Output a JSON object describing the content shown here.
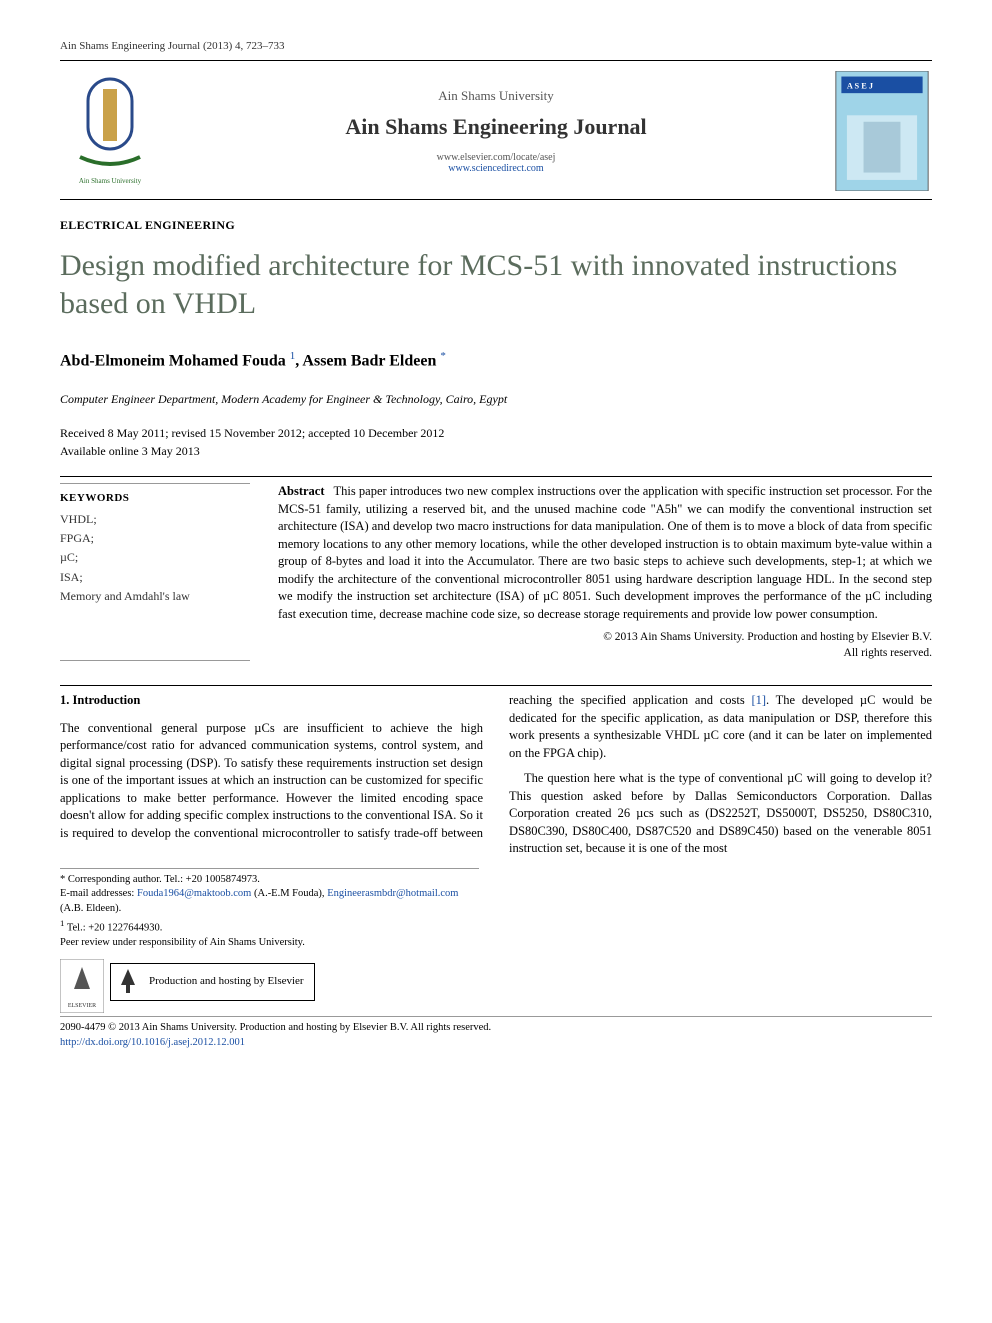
{
  "journal_ref": "Ain Shams Engineering Journal (2013) 4, 723–733",
  "header": {
    "university": "Ain Shams University",
    "journal": "Ain Shams Engineering Journal",
    "link1": "www.elsevier.com/locate/asej",
    "link2": "www.sciencedirect.com"
  },
  "section": "ELECTRICAL ENGINEERING",
  "title": "Design modified architecture for MCS-51 with innovated instructions based on VHDL",
  "authors": {
    "a1": "Abd-Elmoneim Mohamed Fouda",
    "a1_sup": "1",
    "a2": "Assem Badr Eldeen",
    "a2_sup": "*"
  },
  "affiliation": "Computer Engineer Department, Modern Academy for Engineer & Technology, Cairo, Egypt",
  "dates_line1": "Received 8 May 2011; revised 15 November 2012; accepted 10 December 2012",
  "dates_line2": "Available online 3 May 2013",
  "keywords": {
    "title": "KEYWORDS",
    "items": [
      "VHDL;",
      "FPGA;",
      "µC;",
      "ISA;",
      "Memory and Amdahl's law"
    ]
  },
  "abstract": {
    "label": "Abstract",
    "text": "This paper introduces two new complex instructions over the application with specific instruction set processor. For the MCS-51 family, utilizing a reserved bit, and the unused machine code \"A5h\" we can modify the conventional instruction set architecture (ISA) and develop two macro instructions for data manipulation. One of them is to move a block of data from specific memory locations to any other memory locations, while the other developed instruction is to obtain maximum byte-value within a group of 8-bytes and load it into the Accumulator. There are two basic steps to achieve such developments, step-1; at which we modify the architecture of the conventional microcontroller 8051 using hardware description language HDL. In the second step we modify the instruction set architecture (ISA) of µC 8051. Such development improves the performance of the µC including fast execution time, decrease machine code size, so decrease storage requirements and provide low power consumption.",
    "copyright1": "© 2013 Ain Shams University. Production and hosting by Elsevier B.V.",
    "copyright2": "All rights reserved."
  },
  "body": {
    "intro_heading": "1. Introduction",
    "p1": "The conventional general purpose µCs are insufficient to achieve the high performance/cost ratio for advanced communication systems, control system, and digital signal processing (DSP). To satisfy these requirements instruction set design is one of the important issues at which an instruction can be customized for specific applications to make better performance. However the limited encoding space doesn't allow for adding specific complex instructions to the conventional ISA. So it is required to develop the conventional microcontroller to satisfy trade-off between reaching the specified application and costs ",
    "ref1": "[1]",
    "p1b": ". The developed µC would be dedicated for the specific application, as data manipulation or DSP, therefore this work presents a synthesizable VHDL µC core (and it can be later on implemented on the FPGA chip).",
    "p2": "The question here what is the type of conventional µC will going to develop it? This question asked before by Dallas Semiconductors Corporation. Dallas Corporation created 26 µcs such as (DS2252T, DS5000T, DS5250, DS80C310, DS80C390, DS80C400, DS87C520 and DS89C450) based on the venerable 8051 instruction set, because it is one of the most"
  },
  "footnotes": {
    "star": "* Corresponding author. Tel.: +20 1005874973.",
    "emails_label": "E-mail addresses:",
    "email1": "Fouda1964@maktoob.com",
    "email1_who": " (A.-E.M Fouda), ",
    "email2": "Engineerasmbdr@hotmail.com",
    "email2_who": " (A.B. Eldeen).",
    "n1": "Tel.: +20 1227644930.",
    "peer": "Peer review under responsibility of Ain Shams University.",
    "hosting": "Production and hosting by Elsevier"
  },
  "footer": {
    "line1": "2090-4479 © 2013 Ain Shams University. Production and hosting by Elsevier B.V. All rights reserved.",
    "doi": "http://dx.doi.org/10.1016/j.asej.2012.12.001"
  }
}
